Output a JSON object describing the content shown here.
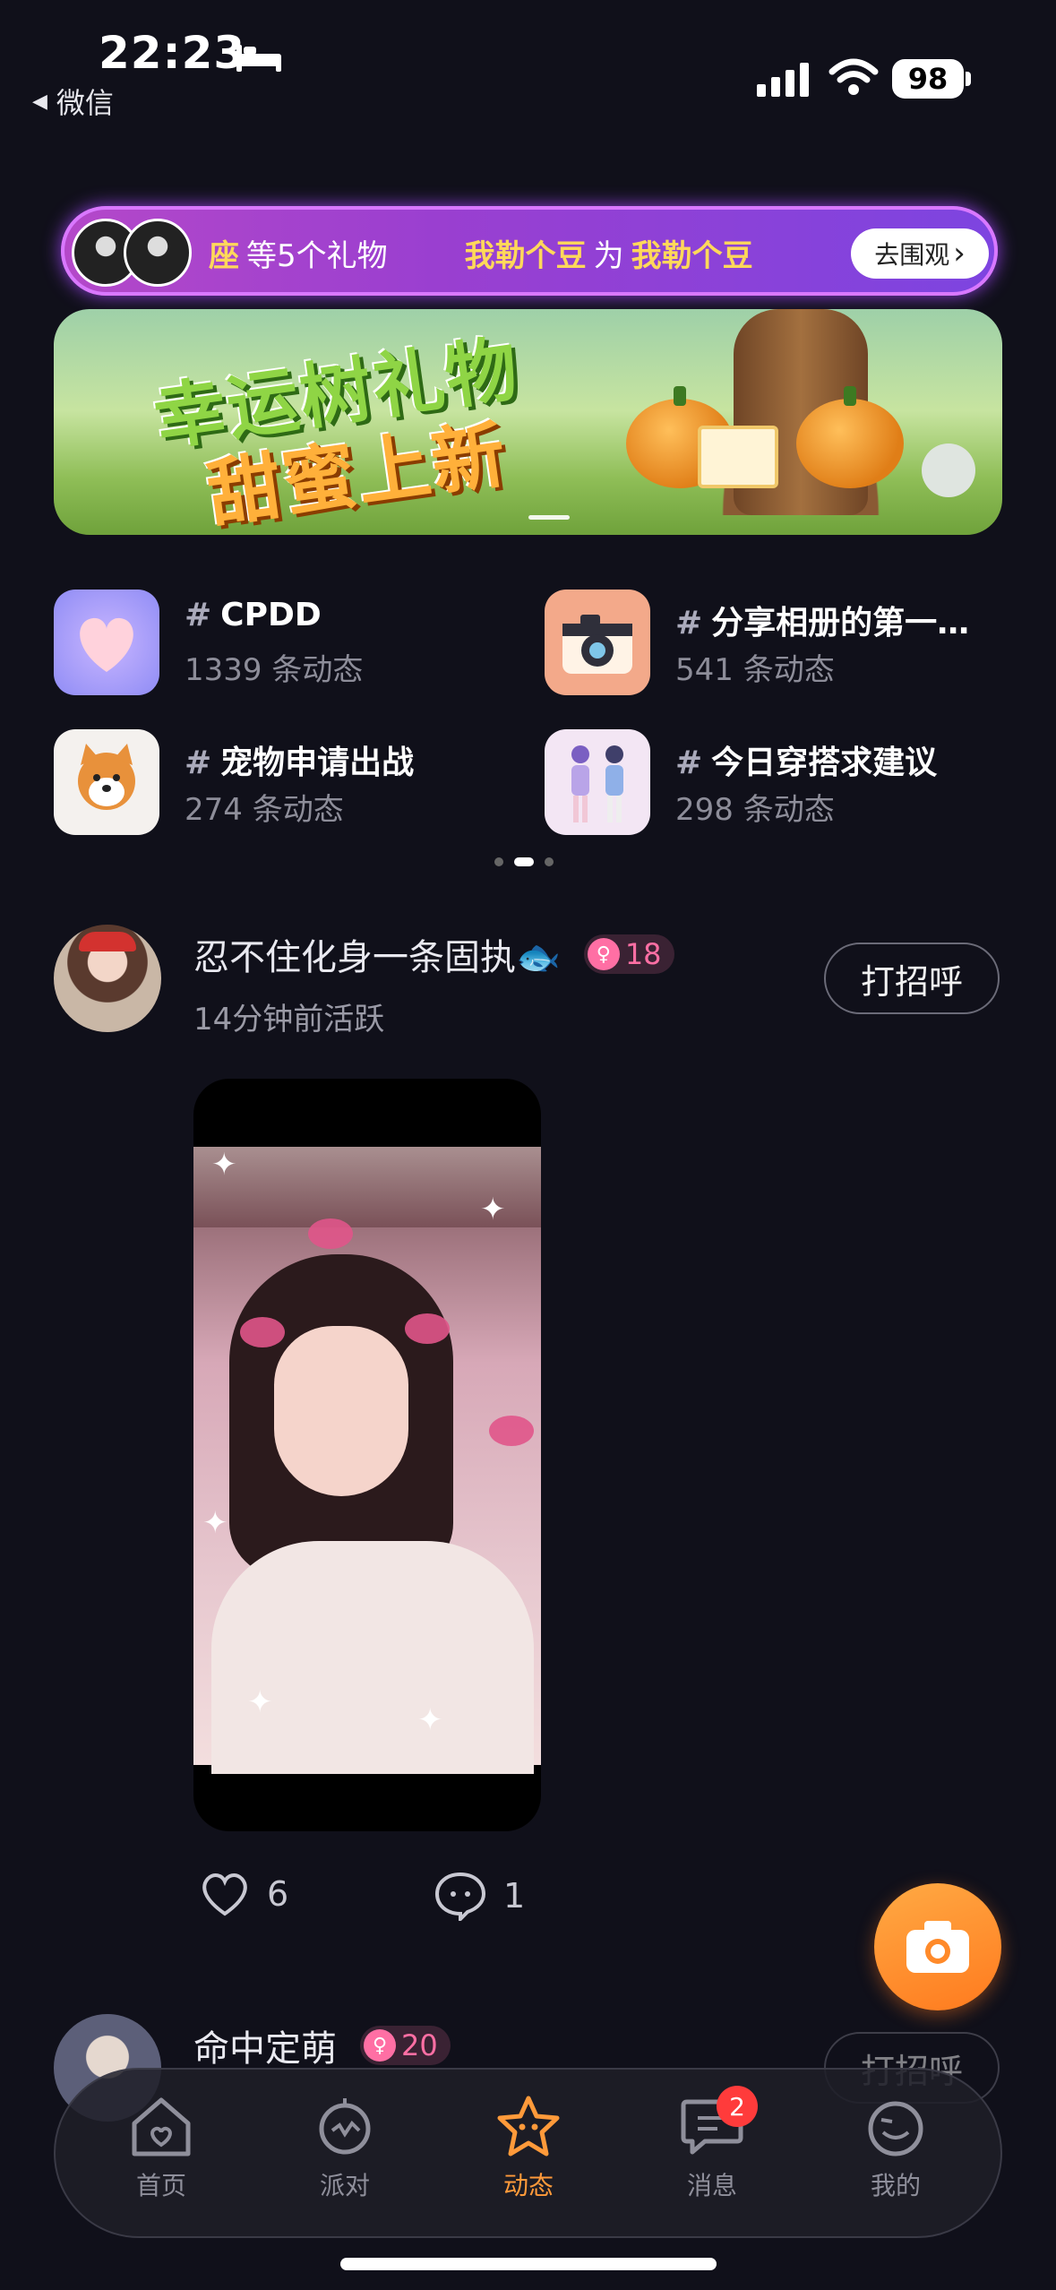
{
  "status_bar": {
    "time": "22:23",
    "back_label": "微信",
    "battery": "98"
  },
  "gift_ticker": {
    "text_1": "座",
    "text_2": "等5个礼物",
    "name_1": "我勒个豆",
    "text_3": "为",
    "name_2": "我勒个豆",
    "watch_label": "去围观",
    "chevron": "›"
  },
  "banner": {
    "title_line1": "幸运树礼物",
    "title_line2": "甜蜜上新"
  },
  "topics": [
    {
      "title": "CPDD",
      "count": "1339 条动态",
      "icon": "heart-icon"
    },
    {
      "title": "分享相册的第一…",
      "count": "541 条动态",
      "icon": "camera-icon"
    },
    {
      "title": "宠物申请出战",
      "count": "274 条动态",
      "icon": "dog-icon"
    },
    {
      "title": "今日穿搭求建议",
      "count": "298 条动态",
      "icon": "outfit-icon"
    }
  ],
  "hash_symbol": "#",
  "posts": [
    {
      "username": "忍不住化身一条固执🐟",
      "level": "18",
      "active": "14分钟前活跃",
      "greet": "打招呼",
      "likes": "6",
      "comments": "1"
    },
    {
      "username": "命中定萌",
      "level": "20",
      "greet": "打招呼"
    }
  ],
  "tabs": [
    {
      "label": "首页",
      "icon": "home-icon"
    },
    {
      "label": "派对",
      "icon": "party-icon"
    },
    {
      "label": "动态",
      "icon": "feed-icon"
    },
    {
      "label": "消息",
      "icon": "message-icon"
    },
    {
      "label": "我的",
      "icon": "profile-icon"
    }
  ],
  "message_badge": "2",
  "colors": {
    "background": "#10101a",
    "accent": "#ff9a3a",
    "level_pink": "#ff6fa4",
    "badge_red": "#ff3b3b"
  }
}
